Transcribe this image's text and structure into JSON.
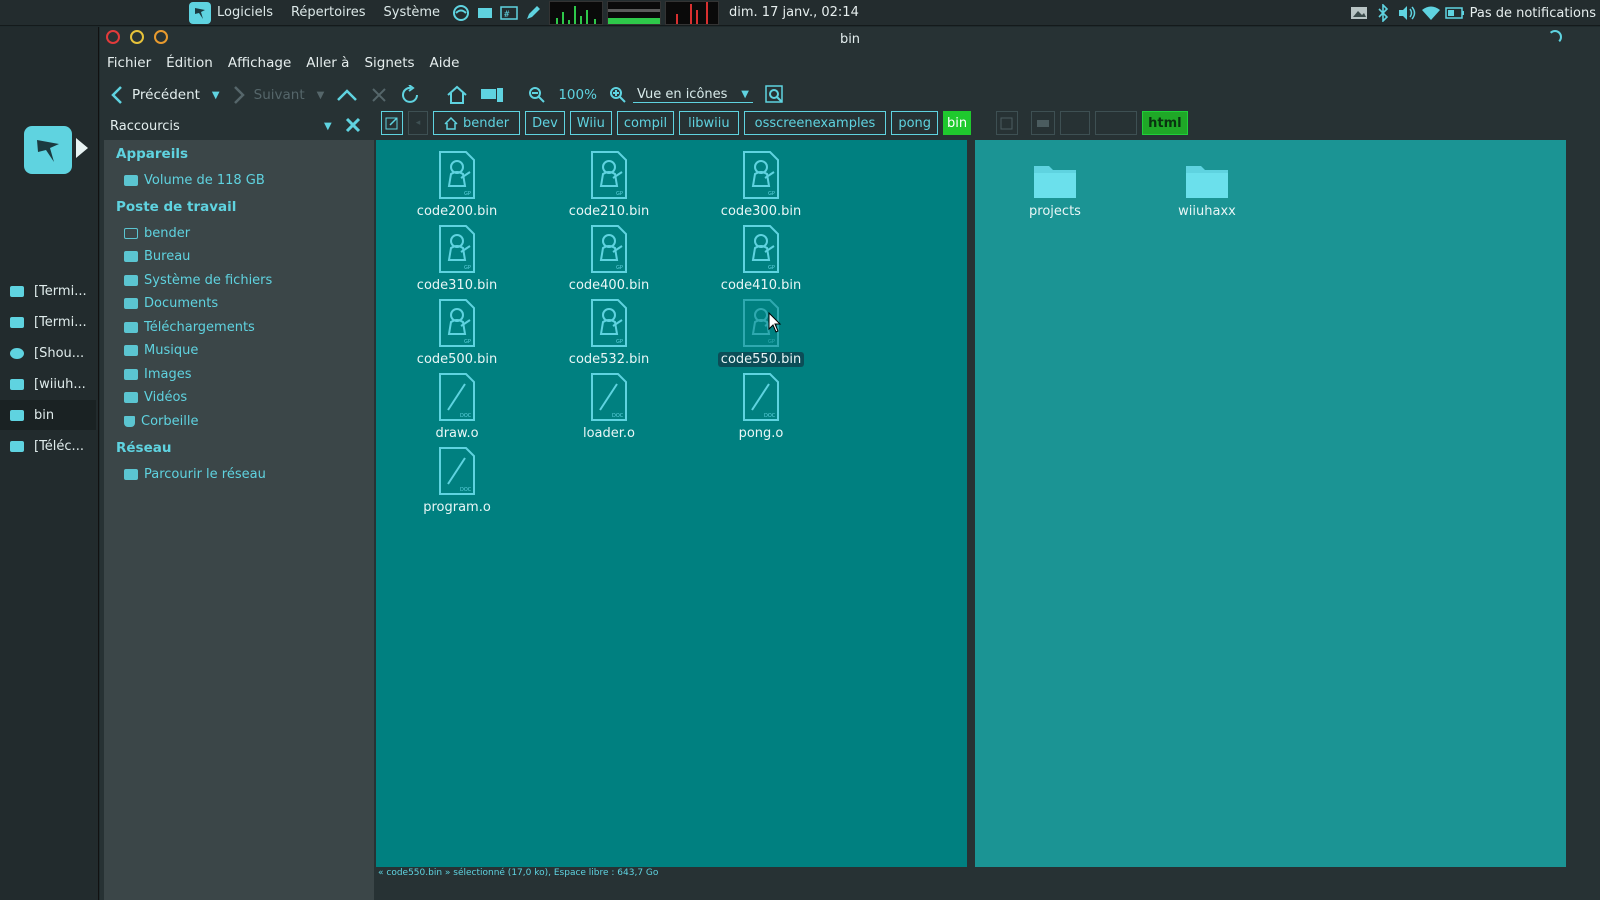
{
  "top_panel": {
    "menus": [
      "Logiciels",
      "Répertoires",
      "Système"
    ],
    "clock": "dim. 17 janv., 02:14",
    "notifications": "Pas de notifications",
    "tray_icons": [
      "photo-icon",
      "bluetooth-icon",
      "volume-icon",
      "wifi-icon",
      "battery-icon"
    ]
  },
  "dock": {
    "items": [
      {
        "label": "[Termi...",
        "icon": "terminal-icon"
      },
      {
        "label": "[Termi...",
        "icon": "terminal-icon"
      },
      {
        "label": "[Shou...",
        "icon": "refresh-icon"
      },
      {
        "label": "[wiiuh...",
        "icon": "folder-icon"
      },
      {
        "label": "bin",
        "icon": "folder-icon",
        "active": true
      },
      {
        "label": "[Téléc...",
        "icon": "download-icon"
      }
    ]
  },
  "window": {
    "title": "bin"
  },
  "menubar": [
    "Fichier",
    "Édition",
    "Affichage",
    "Aller à",
    "Signets",
    "Aide"
  ],
  "toolbar": {
    "back": "Précédent",
    "forward": "Suivant",
    "zoom": "100%",
    "view_mode": "Vue en icônes"
  },
  "sidebar": {
    "title": "Raccourcis",
    "sections": [
      {
        "heading": "Appareils",
        "items": [
          "Volume de 118 GB"
        ]
      },
      {
        "heading": "Poste de travail",
        "items": [
          "bender",
          "Bureau",
          "Système de fichiers",
          "Documents",
          "Téléchargements",
          "Musique",
          "Images",
          "Vidéos",
          "Corbeille"
        ]
      },
      {
        "heading": "Réseau",
        "items": [
          "Parcourir le réseau"
        ]
      }
    ]
  },
  "pathbar": {
    "left": [
      "bender",
      "Dev",
      "Wiiu",
      "compil",
      "libwiiu",
      "osscreenexamples",
      "pong",
      "bin"
    ],
    "right_active": "html"
  },
  "pane_left": {
    "files": [
      {
        "name": "code200.bin",
        "type": "bin"
      },
      {
        "name": "code210.bin",
        "type": "bin"
      },
      {
        "name": "code300.bin",
        "type": "bin"
      },
      {
        "name": "code310.bin",
        "type": "bin"
      },
      {
        "name": "code400.bin",
        "type": "bin"
      },
      {
        "name": "code410.bin",
        "type": "bin"
      },
      {
        "name": "code500.bin",
        "type": "bin"
      },
      {
        "name": "code532.bin",
        "type": "bin"
      },
      {
        "name": "code550.bin",
        "type": "bin",
        "selected": true
      },
      {
        "name": "draw.o",
        "type": "obj"
      },
      {
        "name": "loader.o",
        "type": "obj"
      },
      {
        "name": "pong.o",
        "type": "obj"
      },
      {
        "name": "program.o",
        "type": "obj"
      }
    ]
  },
  "pane_right": {
    "files": [
      {
        "name": "projects",
        "type": "folder"
      },
      {
        "name": "wiiuhaxx",
        "type": "folder"
      }
    ]
  },
  "status": "« code550.bin » sélectionné (17,0 ko), Espace libre : 643,7 Go",
  "colors": {
    "accent": "#5fd3e0",
    "pane_left": "#008080",
    "pane_right": "#1b9494",
    "green": "#1fc92e"
  }
}
